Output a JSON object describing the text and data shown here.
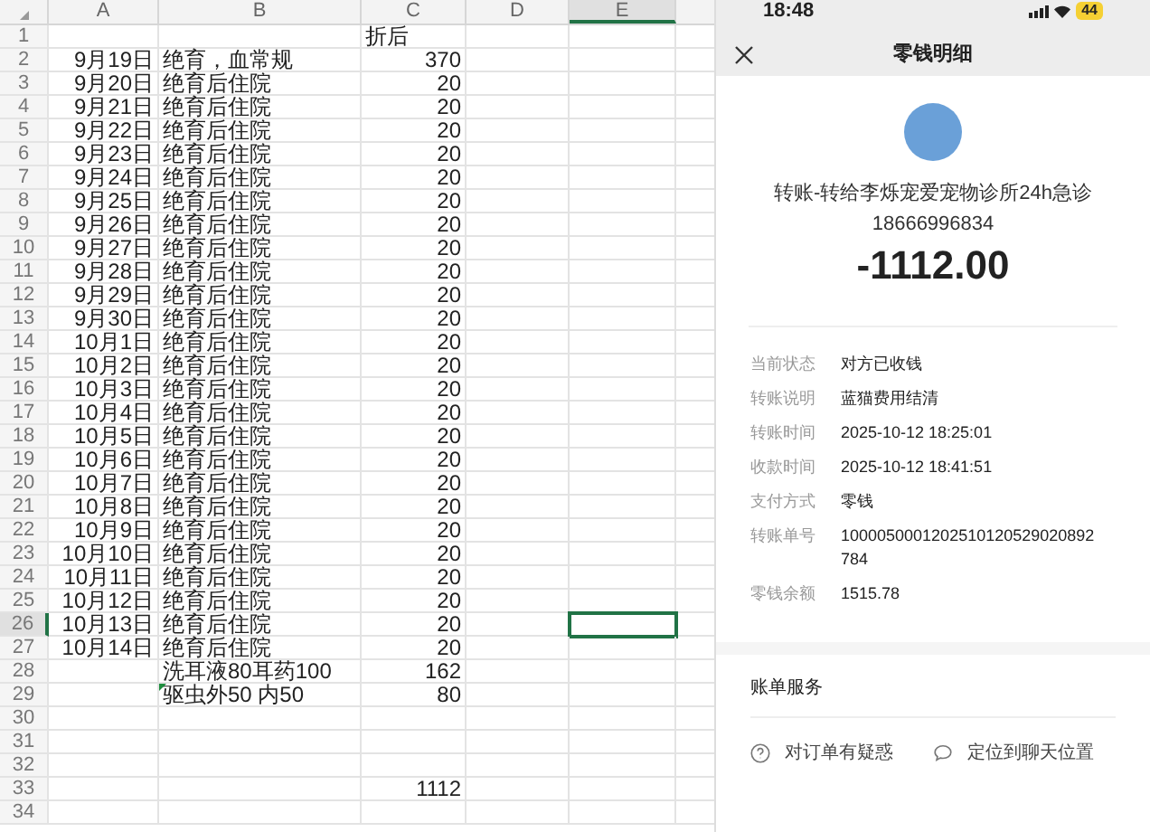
{
  "sheet": {
    "columns": [
      {
        "label": "A",
        "selected": false
      },
      {
        "label": "B",
        "selected": false
      },
      {
        "label": "C",
        "selected": false
      },
      {
        "label": "D",
        "selected": false
      },
      {
        "label": "E",
        "selected": true
      }
    ],
    "rows": [
      {
        "num": "1",
        "a": "",
        "b": "",
        "c": "折后",
        "selected": false,
        "marker": false
      },
      {
        "num": "2",
        "a": "9月19日",
        "b": "绝育，血常规",
        "c": "370",
        "selected": false,
        "marker": false
      },
      {
        "num": "3",
        "a": "9月20日",
        "b": "绝育后住院",
        "c": "20",
        "selected": false,
        "marker": false
      },
      {
        "num": "4",
        "a": "9月21日",
        "b": "绝育后住院",
        "c": "20",
        "selected": false,
        "marker": false
      },
      {
        "num": "5",
        "a": "9月22日",
        "b": "绝育后住院",
        "c": "20",
        "selected": false,
        "marker": false
      },
      {
        "num": "6",
        "a": "9月23日",
        "b": "绝育后住院",
        "c": "20",
        "selected": false,
        "marker": false
      },
      {
        "num": "7",
        "a": "9月24日",
        "b": "绝育后住院",
        "c": "20",
        "selected": false,
        "marker": false
      },
      {
        "num": "8",
        "a": "9月25日",
        "b": "绝育后住院",
        "c": "20",
        "selected": false,
        "marker": false
      },
      {
        "num": "9",
        "a": "9月26日",
        "b": "绝育后住院",
        "c": "20",
        "selected": false,
        "marker": false
      },
      {
        "num": "10",
        "a": "9月27日",
        "b": "绝育后住院",
        "c": "20",
        "selected": false,
        "marker": false
      },
      {
        "num": "11",
        "a": "9月28日",
        "b": "绝育后住院",
        "c": "20",
        "selected": false,
        "marker": false
      },
      {
        "num": "12",
        "a": "9月29日",
        "b": "绝育后住院",
        "c": "20",
        "selected": false,
        "marker": false
      },
      {
        "num": "13",
        "a": "9月30日",
        "b": "绝育后住院",
        "c": "20",
        "selected": false,
        "marker": false
      },
      {
        "num": "14",
        "a": "10月1日",
        "b": "绝育后住院",
        "c": "20",
        "selected": false,
        "marker": false
      },
      {
        "num": "15",
        "a": "10月2日",
        "b": "绝育后住院",
        "c": "20",
        "selected": false,
        "marker": false
      },
      {
        "num": "16",
        "a": "10月3日",
        "b": "绝育后住院",
        "c": "20",
        "selected": false,
        "marker": false
      },
      {
        "num": "17",
        "a": "10月4日",
        "b": "绝育后住院",
        "c": "20",
        "selected": false,
        "marker": false
      },
      {
        "num": "18",
        "a": "10月5日",
        "b": "绝育后住院",
        "c": "20",
        "selected": false,
        "marker": false
      },
      {
        "num": "19",
        "a": "10月6日",
        "b": "绝育后住院",
        "c": "20",
        "selected": false,
        "marker": false
      },
      {
        "num": "20",
        "a": "10月7日",
        "b": "绝育后住院",
        "c": "20",
        "selected": false,
        "marker": false
      },
      {
        "num": "21",
        "a": "10月8日",
        "b": "绝育后住院",
        "c": "20",
        "selected": false,
        "marker": false
      },
      {
        "num": "22",
        "a": "10月9日",
        "b": "绝育后住院",
        "c": "20",
        "selected": false,
        "marker": false
      },
      {
        "num": "23",
        "a": "10月10日",
        "b": "绝育后住院",
        "c": "20",
        "selected": false,
        "marker": false
      },
      {
        "num": "24",
        "a": "10月11日",
        "b": "绝育后住院",
        "c": "20",
        "selected": false,
        "marker": false
      },
      {
        "num": "25",
        "a": "10月12日",
        "b": "绝育后住院",
        "c": "20",
        "selected": false,
        "marker": false
      },
      {
        "num": "26",
        "a": "10月13日",
        "b": "绝育后住院",
        "c": "20",
        "selected": true,
        "marker": false
      },
      {
        "num": "27",
        "a": "10月14日",
        "b": "绝育后住院",
        "c": "20",
        "selected": false,
        "marker": false
      },
      {
        "num": "28",
        "a": "",
        "b": "洗耳液80耳药100",
        "c": "162",
        "selected": false,
        "marker": false
      },
      {
        "num": "29",
        "a": "",
        "b": "驱虫外50 内50",
        "c": "80",
        "selected": false,
        "marker": true
      },
      {
        "num": "30",
        "a": "",
        "b": "",
        "c": "",
        "selected": false,
        "marker": false
      },
      {
        "num": "31",
        "a": "",
        "b": "",
        "c": "",
        "selected": false,
        "marker": false
      },
      {
        "num": "32",
        "a": "",
        "b": "",
        "c": "",
        "selected": false,
        "marker": false
      },
      {
        "num": "33",
        "a": "",
        "b": "",
        "c": "1112",
        "selected": false,
        "marker": false
      },
      {
        "num": "34",
        "a": "",
        "b": "",
        "c": "",
        "selected": false,
        "marker": false
      }
    ]
  },
  "phone": {
    "status_bar": {
      "time": "18:48",
      "battery": "44"
    },
    "title": "零钱明细",
    "payee_lines": [
      "转账-转给李烁宠爱宠物诊所24h急诊",
      "18666996834"
    ],
    "amount": "-1112.00",
    "details": [
      {
        "label": "当前状态",
        "value": "对方已收钱"
      },
      {
        "label": "转账说明",
        "value": "蓝猫费用结清"
      },
      {
        "label": "转账时间",
        "value": "2025-10-12 18:25:01"
      },
      {
        "label": "收款时间",
        "value": "2025-10-12 18:41:51"
      },
      {
        "label": "支付方式",
        "value": "零钱"
      },
      {
        "label": "转账单号",
        "value": "1000050001202510120529020892784"
      },
      {
        "label": "零钱余额",
        "value": "1515.78"
      }
    ],
    "services": {
      "title": "账单服务",
      "items": [
        {
          "kind": "question",
          "label": "对订单有疑惑"
        },
        {
          "kind": "chat",
          "label": "定位到聊天位置"
        }
      ]
    }
  }
}
